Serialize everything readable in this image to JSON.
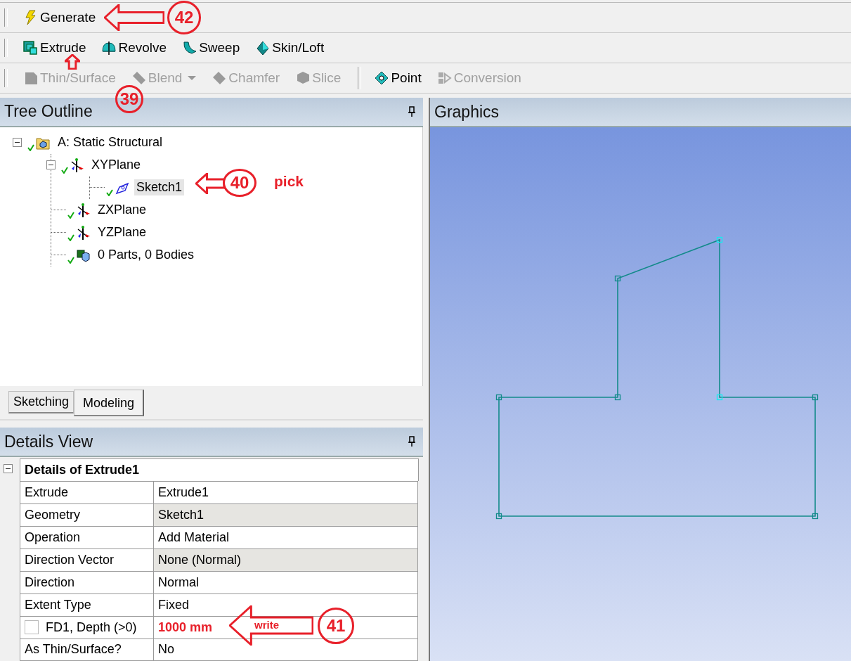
{
  "toolbars": [
    {
      "groups": [
        [
          {
            "label": "Generate",
            "kind": "lightning",
            "disabled": false
          }
        ]
      ]
    },
    {
      "groups": [
        [
          {
            "label": "Extrude",
            "kind": "extrude",
            "disabled": false
          },
          {
            "label": "Revolve",
            "kind": "revolve",
            "disabled": false
          },
          {
            "label": "Sweep",
            "kind": "sweep",
            "disabled": false
          },
          {
            "label": "Skin/Loft",
            "kind": "loft",
            "disabled": false
          }
        ]
      ]
    },
    {
      "groups": [
        [
          {
            "label": "Thin/Surface",
            "kind": "thin",
            "disabled": true
          },
          {
            "label": "Blend",
            "kind": "blend",
            "disabled": true,
            "dropdown": true
          },
          {
            "label": "Chamfer",
            "kind": "chamfer",
            "disabled": true
          },
          {
            "label": "Slice",
            "kind": "slice",
            "disabled": true
          }
        ],
        [
          {
            "label": "Point",
            "kind": "point",
            "disabled": false
          },
          {
            "label": "Conversion",
            "kind": "conversion",
            "disabled": true
          }
        ]
      ]
    }
  ],
  "tree_outline": {
    "title": "Tree Outline",
    "items": [
      {
        "label": "A: Static Structural",
        "kind": "root",
        "expanded": true,
        "selected": false,
        "children": [
          {
            "label": "XYPlane",
            "kind": "plane",
            "expanded": true,
            "selected": false,
            "children": [
              {
                "label": "Sketch1",
                "kind": "sketch",
                "selected": true
              }
            ]
          },
          {
            "label": "ZXPlane",
            "kind": "plane",
            "selected": false
          },
          {
            "label": "YZPlane",
            "kind": "plane",
            "selected": false
          },
          {
            "label": "0 Parts, 0 Bodies",
            "kind": "body",
            "selected": false
          }
        ]
      }
    ]
  },
  "tabs": [
    {
      "label": "Sketching",
      "selected": false
    },
    {
      "label": "Modeling",
      "selected": true
    }
  ],
  "details_view": {
    "title": "Details View",
    "section": {
      "title": "Details of Extrude1",
      "expanded": true
    },
    "rows": [
      {
        "label": "Extrude",
        "value": "Extrude1",
        "shaded": false
      },
      {
        "label": "Geometry",
        "value": "Sketch1",
        "shaded": true
      },
      {
        "label": "Operation",
        "value": "Add Material",
        "shaded": false
      },
      {
        "label": "Direction Vector",
        "value": "None (Normal)",
        "shaded": true
      },
      {
        "label": "Direction",
        "value": "Normal",
        "shaded": false
      },
      {
        "label": "Extent Type",
        "value": "Fixed",
        "shaded": false
      },
      {
        "label": "FD1,  Depth (>0)",
        "value": "1000 mm",
        "shaded": false,
        "checkbox": {
          "checked": false
        },
        "highlighted": true
      },
      {
        "label": "As Thin/Surface?",
        "value": "No",
        "shaded": false
      }
    ]
  },
  "graphics": {
    "title": "Graphics"
  },
  "annotations": [
    {
      "number": "42",
      "kind": "left"
    },
    {
      "number": "39",
      "kind": "up"
    },
    {
      "number": "40",
      "kind": "left",
      "note": "pick"
    },
    {
      "number": "41",
      "kind": "left",
      "note": "write"
    }
  ]
}
